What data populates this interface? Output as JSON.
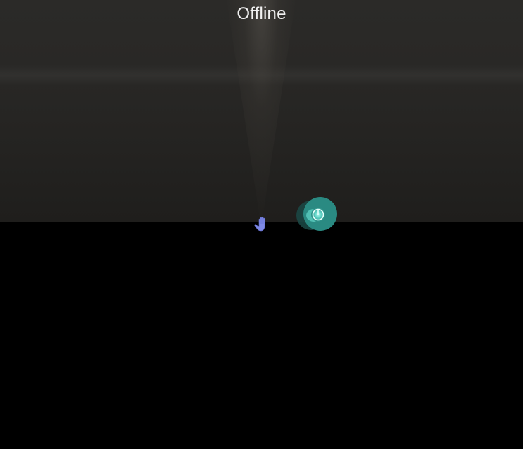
{
  "status": {
    "title": "Offline"
  },
  "icons": {
    "pointer": "hand-pointer-icon",
    "teleport": "teleport-orb-icon"
  },
  "colors": {
    "wall": "#282725",
    "floor": "#000000",
    "title_text": "#f2f2f2",
    "hand": "#7f8ae6",
    "orb_outer": "#2a8a82",
    "orb_inner": "#8ff2e6",
    "orb_shadow": "#1b4a46"
  }
}
